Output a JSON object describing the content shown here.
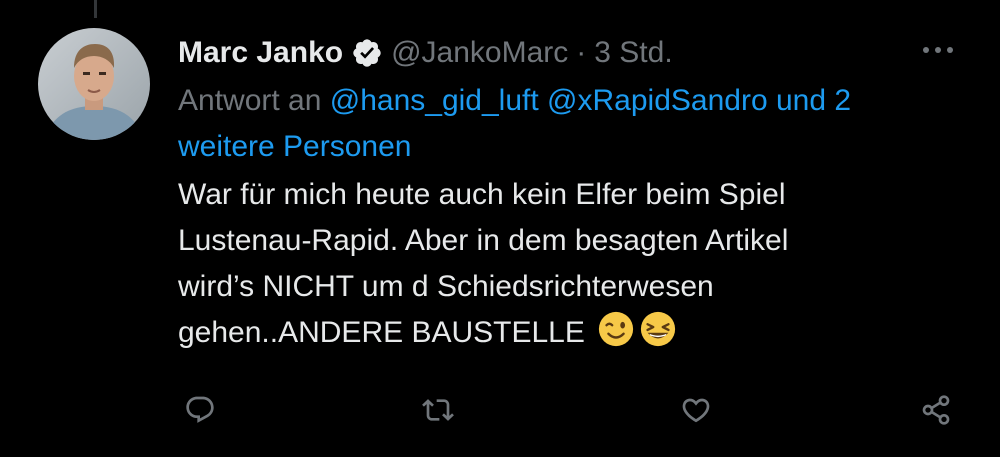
{
  "author": {
    "name": "Marc Janko",
    "handle": "@JankoMarc",
    "separator": "·",
    "time": "3 Std."
  },
  "reply": {
    "prefix": "Antwort an",
    "mention_1": "@hans_gid_luft",
    "mention_2": "@xRapidSandro",
    "middle": "und 2",
    "more_people": "weitere Personen"
  },
  "tweet": {
    "line_1": "War für mich heute auch kein Elfer beim Spiel",
    "line_2": "Lustenau-Rapid. Aber in dem besagten Artikel",
    "line_3": "wird’s NICHT um d Schiedsrichterwesen",
    "line_4": "gehen..ANDERE BAUSTELLE",
    "emojis": [
      "winking-face-emoji",
      "grinning-squinting-face-emoji"
    ]
  },
  "icons": {
    "verified": "verified-badge-icon",
    "more": "more-icon",
    "reply": "reply-icon",
    "retweet": "retweet-icon",
    "like": "like-icon",
    "share": "share-icon"
  },
  "colors": {
    "background": "#000000",
    "text": "#e7e9ea",
    "muted": "#71767b",
    "link": "#1d9bf0"
  }
}
